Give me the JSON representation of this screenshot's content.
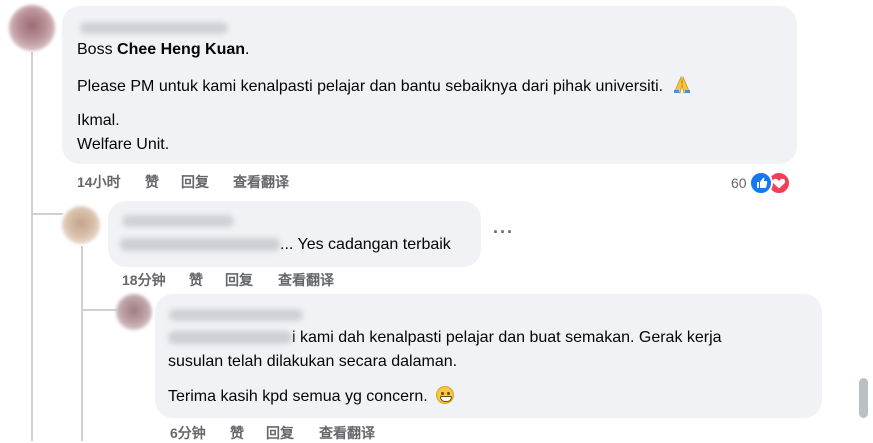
{
  "comment1": {
    "text_prefix": "Boss ",
    "mention": "Chee Heng Kuan",
    "text_suffix": ".",
    "line2": "Please PM untuk kami kenalpasti pelajar dan bantu sebaiknya dari pihak universiti.",
    "emoji": "folded-hands",
    "line3": "Ikmal.",
    "line4": "Welfare Unit.",
    "time": "14小时",
    "like_label": "赞",
    "reply_label": "回复",
    "translate_label": "查看翻译",
    "reaction_count": "60",
    "reaction_icons": [
      "like-icon",
      "love-icon"
    ]
  },
  "comment2": {
    "text_suffix": "... Yes cadangan terbaik",
    "more_label": "···",
    "time": "18分钟",
    "like_label": "赞",
    "reply_label": "回复",
    "translate_label": "查看翻译"
  },
  "comment3": {
    "line1_suffix": "i kami dah kenalpasti pelajar dan buat semakan. Gerak kerja",
    "line2": "susulan telah dilakukan secara dalaman.",
    "line3": "Terima kasih kpd semua yg concern.",
    "emoji": "grinning-face",
    "time": "6分钟",
    "like_label": "赞",
    "reply_label": "回复",
    "translate_label": "查看翻译"
  },
  "colors": {
    "bubble": "#f0f2f5",
    "meta_text": "#65676b",
    "like": "#1877f2",
    "love": "#f33e58",
    "thread_line": "#ced0d4"
  }
}
